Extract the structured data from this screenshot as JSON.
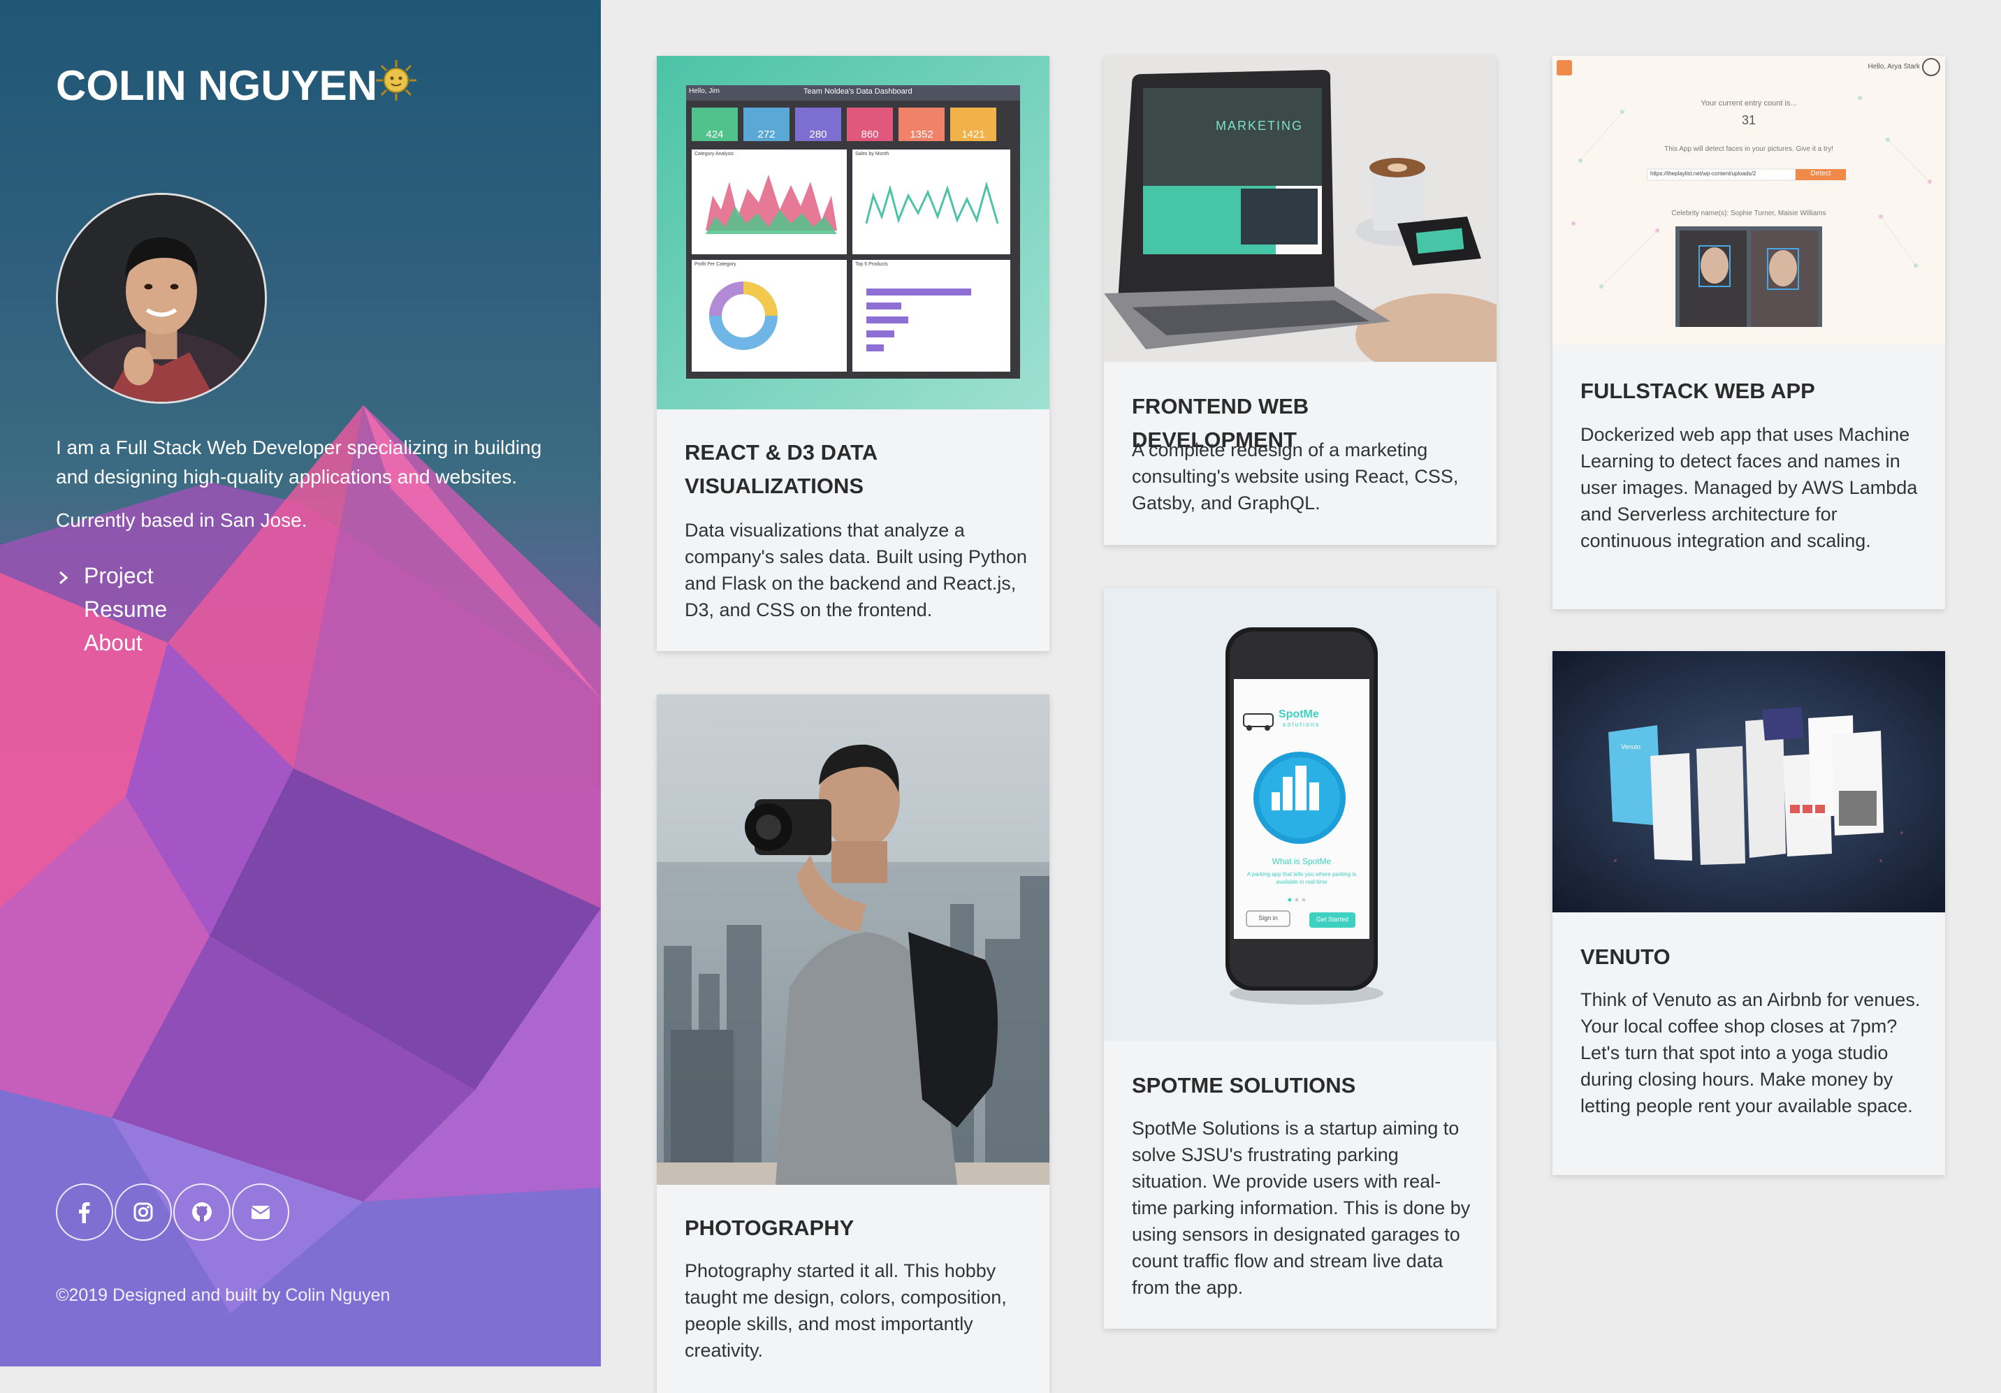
{
  "sidebar": {
    "name": "COLIN NGUYEN",
    "bio": "I am a Full Stack Web Developer specializing in building and designing high-quality applications and websites.",
    "location": "Currently based in San Jose.",
    "nav": [
      {
        "label": "Project"
      },
      {
        "label": "Resume"
      },
      {
        "label": "About"
      }
    ],
    "socials": [
      {
        "icon": "facebook-icon"
      },
      {
        "icon": "instagram-icon"
      },
      {
        "icon": "github-icon"
      },
      {
        "icon": "envelope-icon"
      }
    ],
    "copyright": "©2019 Designed and built by Colin Nguyen"
  },
  "projects": [
    {
      "title": "REACT & D3 DATA VISUALIZATIONS",
      "description": "Data visualizations that analyze a company's sales data. Built using Python and Flask on the backend and React.js, D3, and CSS on the frontend.",
      "dashboard": {
        "greeting": "Hello, Jim",
        "title": "Team Noldea's Data Dashboard",
        "stats": [
          "424",
          "272",
          "280",
          "860",
          "1352",
          "1421"
        ],
        "panels": [
          "Category Analysis",
          "Sales by Month",
          "Profit Per Category",
          "Top 5 Products"
        ]
      }
    },
    {
      "title": "FRONTEND WEB DEVELOPMENT",
      "description": "A complete redesign of a marketing consulting's website using React, CSS, Gatsby, and GraphQL.",
      "screen_text": "MARKETING"
    },
    {
      "title": "FULLSTACK WEB APP",
      "description": "Dockerized web app that uses Machine Learning to detect faces and names in user images. Managed by AWS Lambda and Serverless architecture for continuous integration and scaling.",
      "app": {
        "user": "Hello, Arya Stark",
        "entry_label": "Your current entry count is...",
        "entry_count": "31",
        "hint": "This App will detect faces in your pictures. Give it a try!",
        "url_value": "https://theplaylist.net/wp-content/uploads/2",
        "detect_button": "Detect",
        "result": "Celebrity name(s): Sophie Turner, Maisie Williams"
      }
    },
    {
      "title": "PHOTOGRAPHY",
      "description": "Photography started it all. This hobby taught me design, colors, composition, people skills, and most importantly creativity."
    },
    {
      "title": "SPOTME SOLUTIONS",
      "description": "SpotMe Solutions is a startup aiming to solve SJSU's frustrating parking situation. We provide users with real-time parking information. This is done by using sensors in designated garages to count traffic flow and stream live data from the app.",
      "phone": {
        "brand": "SpotMe",
        "tagline": "solutions",
        "question": "What is SpotMe",
        "blurb": "A parking app that tells you where parking is available in real-time",
        "sign_in": "Sign in",
        "get_started": "Get Started"
      }
    },
    {
      "title": "VENUTO",
      "description": "Think of Venuto as an Airbnb for venues. Your local coffee shop closes at 7pm? Let's turn that spot into a yoga studio during closing hours. Make money by letting people rent your available space.",
      "screen_brand": "Venuto"
    }
  ],
  "colors": {
    "card_bg": "#f2f4f6",
    "page_bg": "#ececec",
    "title_text": "#2b2b2b",
    "teal": "#5cc9b0",
    "stat_colors": [
      "#52c28c",
      "#5aa8d6",
      "#7d6fd1",
      "#e0587c",
      "#f0826a",
      "#f2b24a"
    ]
  }
}
